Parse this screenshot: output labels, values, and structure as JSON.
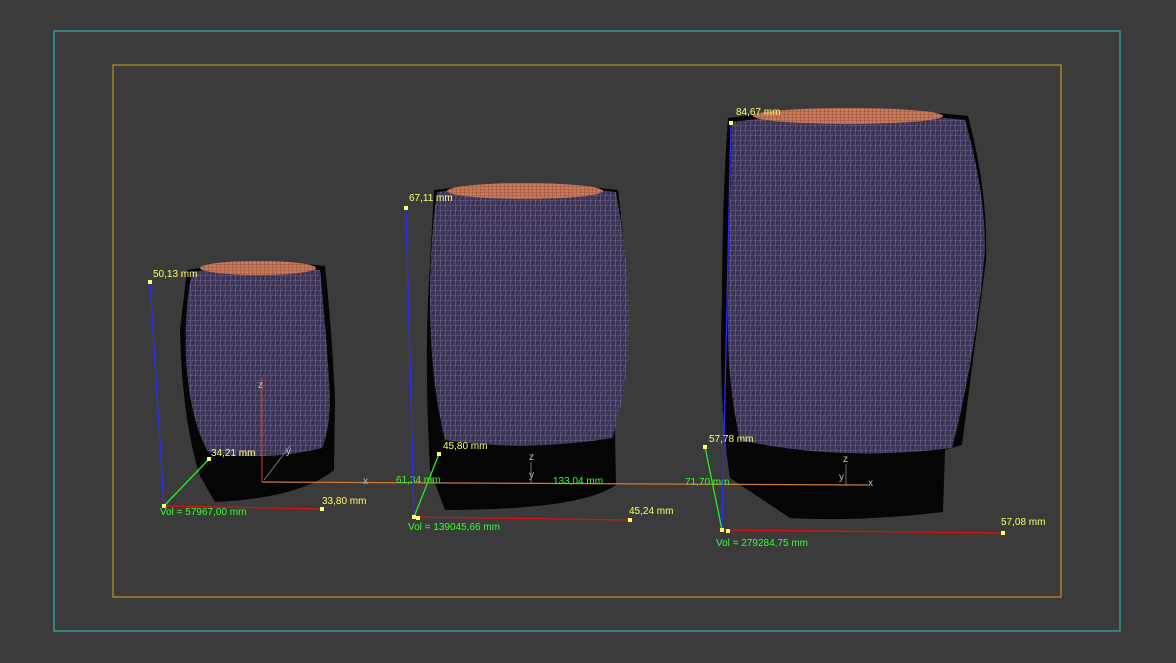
{
  "viewport": {
    "safe_frame_color": "#2fa9a9",
    "render_region_color": "#b68a24",
    "background": "#3b3b3b"
  },
  "colors": {
    "dimension_text": "#ffff66",
    "volume_text": "#33ff33",
    "height_line": "#2a2aff",
    "depth_line": "#22ee22",
    "width_line": "#dd1111",
    "axis_line": "#d07a33",
    "mesh_fill": "#3c3550",
    "mesh_wire": "#9c8ad8",
    "rim": "#d08060"
  },
  "objects": [
    {
      "name": "small-vase",
      "height_label": "50,13 mm",
      "depth_label": "34,21 mm",
      "width_label": "33,80 mm",
      "volume_label": "Vol = 57967,00 mm"
    },
    {
      "name": "medium-vase",
      "height_label": "67,11 mm",
      "depth_label": "45,80 mm",
      "width_label": "45,24 mm",
      "volume_label": "Vol = 139045,66 mm"
    },
    {
      "name": "large-vase",
      "height_label": "84,67 mm",
      "depth_label": "57,78 mm",
      "width_label": "57,08 mm",
      "volume_label": "Vol = 279284,75 mm"
    }
  ],
  "distances": {
    "gap_1": "61,34 mm",
    "gap_2": "133,04 mm",
    "gap_3": "71,70 mm"
  },
  "gizmo": {
    "x_label": "x",
    "y_label": "y",
    "z_label": "z"
  }
}
